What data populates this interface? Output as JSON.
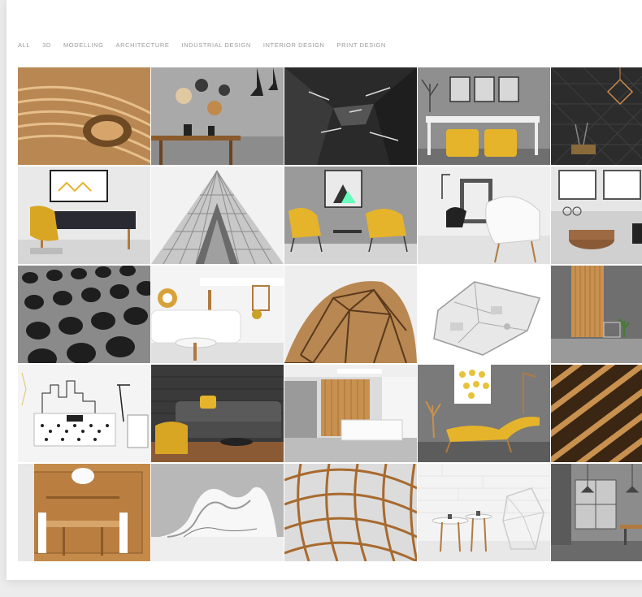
{
  "filters": [
    "ALL",
    "3D",
    "MODELLING",
    "ARCHITECTURE",
    "INDUSTRIAL DESIGN",
    "INTERIOR DESIGN",
    "PRINT DESIGN"
  ],
  "tiles": [
    {
      "subject": "wooden slatted curved architecture"
    },
    {
      "subject": "dining room with cutting boards and pendant lamps"
    },
    {
      "subject": "dark abstract geometric tunnel"
    },
    {
      "subject": "yellow poufs under console with frames"
    },
    {
      "subject": "copper geometric pendant on dark tile wall"
    },
    {
      "subject": "daybed with yellow throw"
    },
    {
      "subject": "triangular glass building facade"
    },
    {
      "subject": "two yellow lounge chairs"
    },
    {
      "subject": "white chairs in bright room"
    },
    {
      "subject": "loft interior with leather pouf"
    },
    {
      "subject": "perforated metal facade"
    },
    {
      "subject": "white sofa living room"
    },
    {
      "subject": "wooden geodesic dome"
    },
    {
      "subject": "3D apartment floor plan"
    },
    {
      "subject": "wood panel wall with plant"
    },
    {
      "subject": "bedroom with city line art"
    },
    {
      "subject": "grey sofa with yellow pillows on brick"
    },
    {
      "subject": "reception desk with wood wall"
    },
    {
      "subject": "yellow chaise lounge with balloon poster"
    },
    {
      "subject": "diagonal wooden slats"
    },
    {
      "subject": "wooden dining room"
    },
    {
      "subject": "white curved modern building"
    },
    {
      "subject": "wooden lattice roof structure"
    },
    {
      "subject": "white tables and wire chair"
    },
    {
      "subject": "industrial grey loft"
    }
  ],
  "colors": {
    "accent_yellow": "#e6b42a",
    "wood": "#c48a4a",
    "filter_text": "#9a9a9a"
  }
}
